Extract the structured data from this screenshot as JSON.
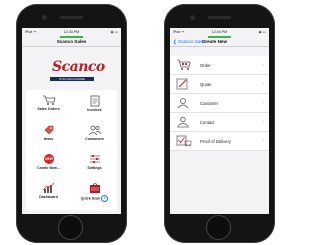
{
  "left_screen": {
    "status": {
      "carrier": "iPod ᯤ",
      "time": "12:43 PM",
      "battery": "◉ ▭"
    },
    "title": "Scanco Sales",
    "logo": {
      "name": "Scanco",
      "tagline": "IS SO MUCH MORE"
    },
    "tiles": [
      {
        "label": "Sales Orders",
        "icon": "cart-icon"
      },
      {
        "label": "Invoices",
        "icon": "invoice-icon"
      },
      {
        "label": "Items",
        "icon": "tag-icon"
      },
      {
        "label": "Customers",
        "icon": "customers-icon"
      },
      {
        "label": "Create New...",
        "icon": "new-badge-icon"
      },
      {
        "label": "Settings",
        "icon": "sliders-icon"
      },
      {
        "label": "Dashboard",
        "icon": "chart-icon"
      },
      {
        "label": "Quick Scan",
        "icon": "barcode-bag-icon"
      }
    ]
  },
  "right_screen": {
    "status": {
      "carrier": "iPod ᯤ",
      "time": "12:44 PM",
      "battery": "◉ ▭"
    },
    "back_label": "❮ Scanco Sales",
    "title": "Create New",
    "items": [
      {
        "label": "Order",
        "icon": "cart-icon"
      },
      {
        "label": "Quote",
        "icon": "pencil-icon"
      },
      {
        "label": "Customer",
        "icon": "customer-icon"
      },
      {
        "label": "Contact",
        "icon": "contact-icon"
      },
      {
        "label": "Proof of Delivery",
        "icon": "delivery-check-icon"
      }
    ],
    "chevron": "›"
  },
  "colors": {
    "accent": "#1a73e8",
    "logo_red": "#b22222",
    "status_green": "#3bb34a"
  }
}
